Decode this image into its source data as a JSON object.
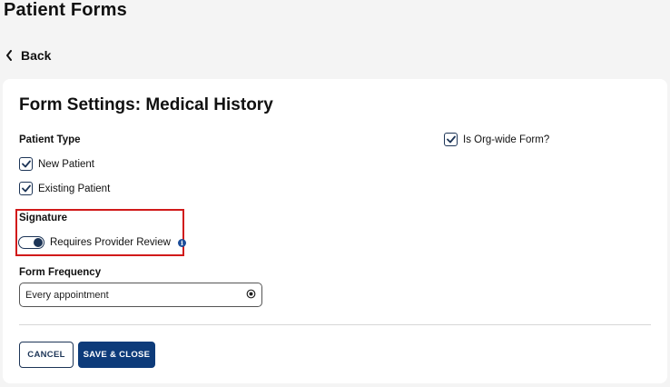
{
  "page": {
    "title": "Patient Forms",
    "back_label": "Back"
  },
  "card": {
    "title": "Form Settings: Medical History",
    "patient_type": {
      "label": "Patient Type",
      "options": [
        {
          "label": "New Patient",
          "checked": true
        },
        {
          "label": "Existing Patient",
          "checked": true
        }
      ]
    },
    "org_wide": {
      "label": "Is Org-wide Form?",
      "checked": true
    },
    "signature": {
      "label": "Signature",
      "toggle_label": "Requires Provider Review",
      "toggle_on": true,
      "info_icon": "info-icon"
    },
    "frequency": {
      "label": "Form Frequency",
      "value": "Every appointment",
      "icon": "radio-target-icon"
    },
    "buttons": {
      "cancel": "CANCEL",
      "save": "SAVE & CLOSE"
    }
  },
  "colors": {
    "primary": "#0d3b7a",
    "checkbox": "#1d3557",
    "highlight": "#d11a1a",
    "background": "#f4f4f4"
  }
}
